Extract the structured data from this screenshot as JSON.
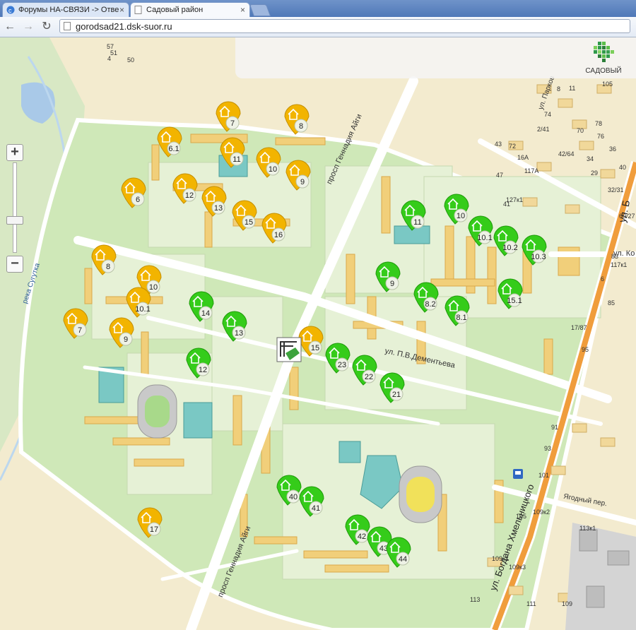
{
  "browser": {
    "tabs": [
      {
        "title": "Форумы НА-СВЯЗИ -> Отве",
        "active": false
      },
      {
        "title": "Садовый район",
        "active": true
      }
    ],
    "url": "gorodsad21.dsk-suor.ru"
  },
  "logo": {
    "text": "САДОВЫЙ"
  },
  "colors": {
    "built": "#f2b400",
    "planned": "#35cc1a",
    "road": "#f09d3c"
  },
  "street_labels": {
    "gennadiya_aigi_n": "просп Геннадия Айги",
    "gennadiya_aigi_s": "просп Геннадия Айги",
    "dementyeva": "ул. П.В.Дементьева",
    "khmelnitskogo": "ул. Богдана Хмельницкого",
    "yagodny": "Ягодный пер.",
    "river": "река Сугутка",
    "ul_ko": "ул. Ко",
    "ul_b": "ул. Б",
    "ul_park": "ул. Парков"
  },
  "house_numbers": [
    "57",
    "51",
    "4",
    "50",
    "8",
    "11",
    "105",
    "74",
    "2/41",
    "78",
    "70",
    "76",
    "72",
    "43",
    "16А",
    "47",
    "41",
    "42/64",
    "34",
    "29",
    "36",
    "40",
    "32/31",
    "60/27",
    "83",
    "6",
    "85",
    "17/87",
    "95",
    "91",
    "93",
    "101",
    "105",
    "109к2",
    "109к1",
    "109к3",
    "113",
    "111",
    "109",
    "113к1",
    "117к1",
    "117А",
    "127к1",
    "4А",
    "93",
    "39",
    "21"
  ],
  "markers_built": [
    "7",
    "8",
    "6.1",
    "11",
    "10",
    "9",
    "6",
    "12",
    "13",
    "15",
    "16",
    "8",
    "10",
    "10.1",
    "7",
    "9",
    "15",
    "17"
  ],
  "markers_planned": [
    "11",
    "10",
    "10.1",
    "10.2",
    "10.3",
    "9",
    "8.2",
    "8.1",
    "15.1",
    "14",
    "13",
    "12",
    "23",
    "22",
    "21",
    "40",
    "41",
    "42",
    "43",
    "44"
  ]
}
